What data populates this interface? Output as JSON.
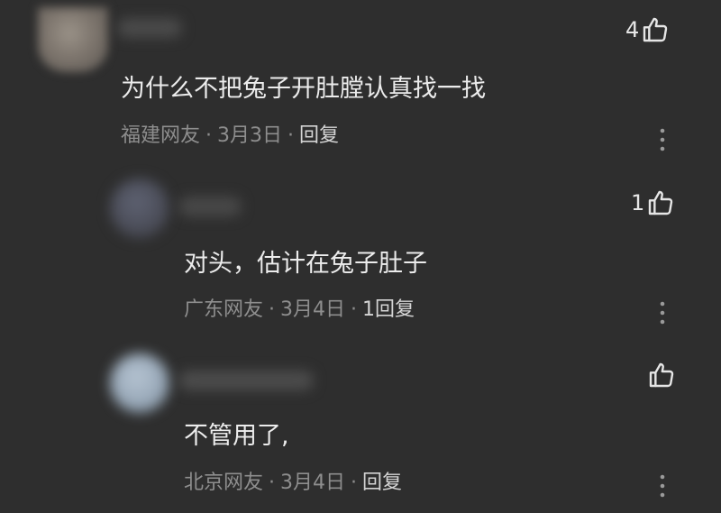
{
  "comments": [
    {
      "content": "为什么不把兔子开肚膛认真找一找",
      "region": "福建网友",
      "date": "3月3日",
      "reply_label": "回复",
      "like_count": "4"
    },
    {
      "content": "对头，估计在兔子肚子",
      "region": "广东网友",
      "date": "3月4日",
      "reply_label": "1回复",
      "like_count": "1"
    },
    {
      "content": "不管用了,",
      "region": "北京网友",
      "date": "3月4日",
      "reply_label": "回复",
      "like_count": ""
    }
  ],
  "separator": "·",
  "icons": {
    "like": "thumbs-up-icon",
    "more": "more-vertical-icon"
  },
  "colors": {
    "background": "#2e2e2e",
    "text": "#ececec",
    "meta": "#8e8e8e"
  }
}
